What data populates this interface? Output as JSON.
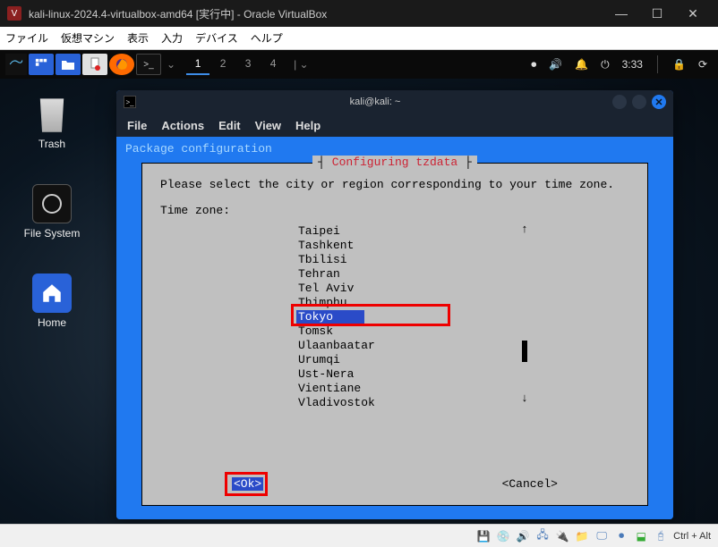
{
  "vbox": {
    "title": "kali-linux-2024.4-virtualbox-amd64 [実行中] - Oracle VirtualBox",
    "menu": [
      "ファイル",
      "仮想マシン",
      "表示",
      "入力",
      "デバイス",
      "ヘルプ"
    ],
    "host_key": "Ctrl + Alt"
  },
  "panel": {
    "workspaces": [
      "1",
      "2",
      "3",
      "4"
    ],
    "active_ws": 0,
    "clock": "3:33"
  },
  "desktop_icons": {
    "trash": "Trash",
    "filesystem": "File System",
    "home": "Home"
  },
  "terminal": {
    "title": "kali@kali: ~",
    "menu": [
      "File",
      "Actions",
      "Edit",
      "View",
      "Help"
    ],
    "header": "Package configuration"
  },
  "dialog": {
    "title": "Configuring tzdata",
    "prompt": "Please select the city or region corresponding to your time zone.",
    "tz_label": "Time zone:",
    "items": [
      "Taipei",
      "Tashkent",
      "Tbilisi",
      "Tehran",
      "Tel Aviv",
      "Thimphu",
      "Tokyo",
      "Tomsk",
      "Ulaanbaatar",
      "Urumqi",
      "Ust-Nera",
      "Vientiane",
      "Vladivostok"
    ],
    "selected": "Tokyo",
    "ok": "<Ok>",
    "cancel": "<Cancel>"
  }
}
